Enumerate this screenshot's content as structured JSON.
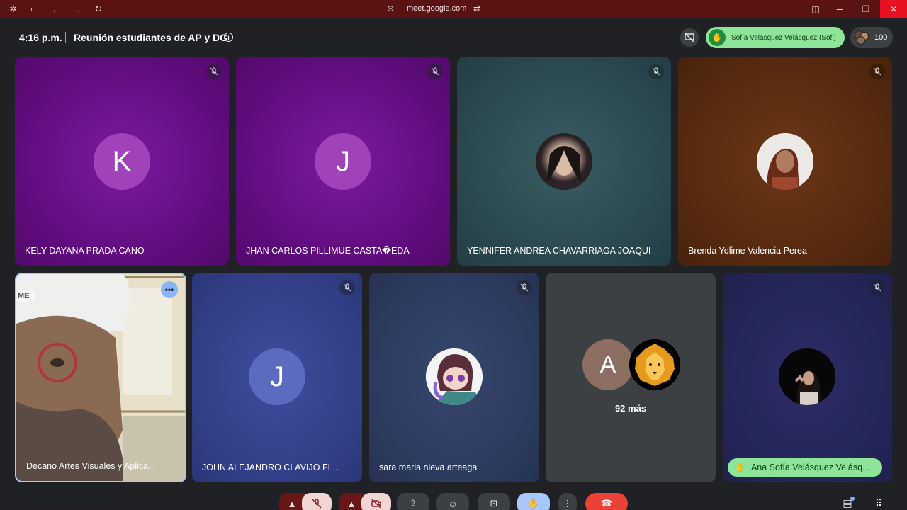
{
  "browser": {
    "url": "meet.google.com"
  },
  "header": {
    "time": "4:16 p.m.",
    "meeting_title": "Reunión estudiantes de AP y DG",
    "raised_hand_text": "Sofía Velásquez Velásquez (Sofi)",
    "participants_count": "100"
  },
  "tiles_top": [
    {
      "name": "KELY DAYANA PRADA CANO",
      "initial": "K",
      "avatar_color": "#a142b8",
      "bg": "#6a0f8a"
    },
    {
      "name": "JHAN CARLOS PILLIMUE CASTA�EDA",
      "initial": "J",
      "avatar_color": "#a142b8",
      "bg": "#6a0f8a"
    },
    {
      "name": "YENNIFER ANDREA CHAVARRIAGA JOAQUI",
      "bg": "#2d4a52"
    },
    {
      "name": "Brenda Yolime Valencia Perea",
      "bg": "#5a2d12"
    }
  ],
  "tiles_bottom": [
    {
      "name": "Decano Artes Visuales y Aplica..."
    },
    {
      "name": "JOHN ALEJANDRO CLAVIJO FL...",
      "initial": "J",
      "avatar_color": "#5c6bc0"
    },
    {
      "name": "sara maria nieva arteaga"
    },
    {
      "overflow_initial": "A",
      "overflow_label": "92 más"
    },
    {
      "speaking_name": "Ana Sofía Velásquez Velásq..."
    }
  ],
  "colors": {
    "accent_green": "#8ee59a",
    "end_call_red": "#ea4335",
    "titlebar": "#5a1212"
  }
}
